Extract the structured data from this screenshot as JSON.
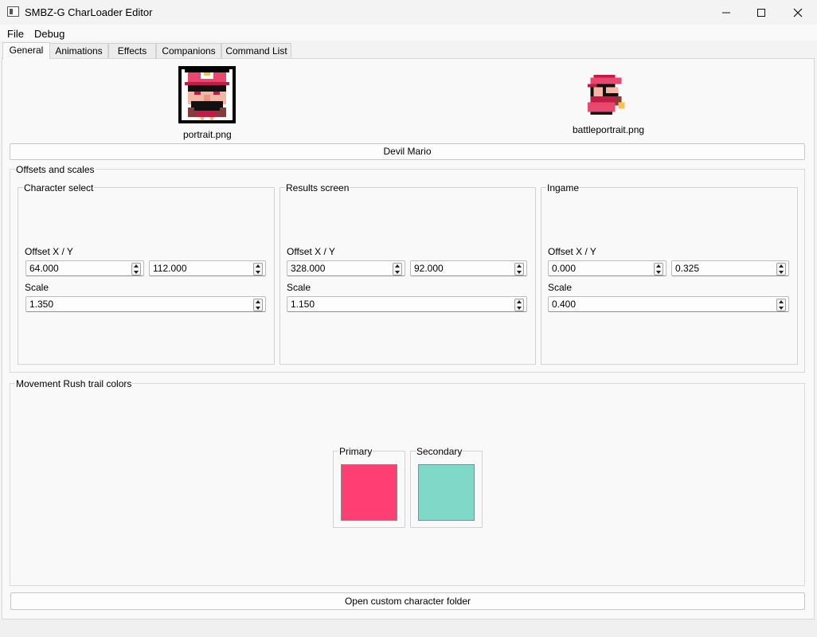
{
  "window": {
    "title": "SMBZ-G CharLoader Editor"
  },
  "menu": [
    "File",
    "Debug"
  ],
  "tabs": [
    "General",
    "Animations",
    "Effects",
    "Companions",
    "Command List"
  ],
  "portraits": {
    "portrait_label": "portrait.png",
    "battle_label": "battleportrait.png"
  },
  "character_name": "Devil Mario",
  "offsets": {
    "title": "Offsets and scales",
    "character_select": {
      "title": "Character select",
      "offset_label": "Offset X / Y",
      "offset_x": "64.000",
      "offset_y": "112.000",
      "scale_label": "Scale",
      "scale": "1.350"
    },
    "results_screen": {
      "title": "Results screen",
      "offset_label": "Offset X / Y",
      "offset_x": "328.000",
      "offset_y": "92.000",
      "scale_label": "Scale",
      "scale": "1.150"
    },
    "ingame": {
      "title": "Ingame",
      "offset_label": "Offset X / Y",
      "offset_x": "0.000",
      "offset_y": "0.325",
      "scale_label": "Scale",
      "scale": "0.400"
    }
  },
  "rush": {
    "title": "Movement Rush trail colors",
    "primary_label": "Primary",
    "primary_color": "#FF3F74",
    "secondary_label": "Secondary",
    "secondary_color": "#80D9C8"
  },
  "open_folder_label": "Open custom character folder"
}
